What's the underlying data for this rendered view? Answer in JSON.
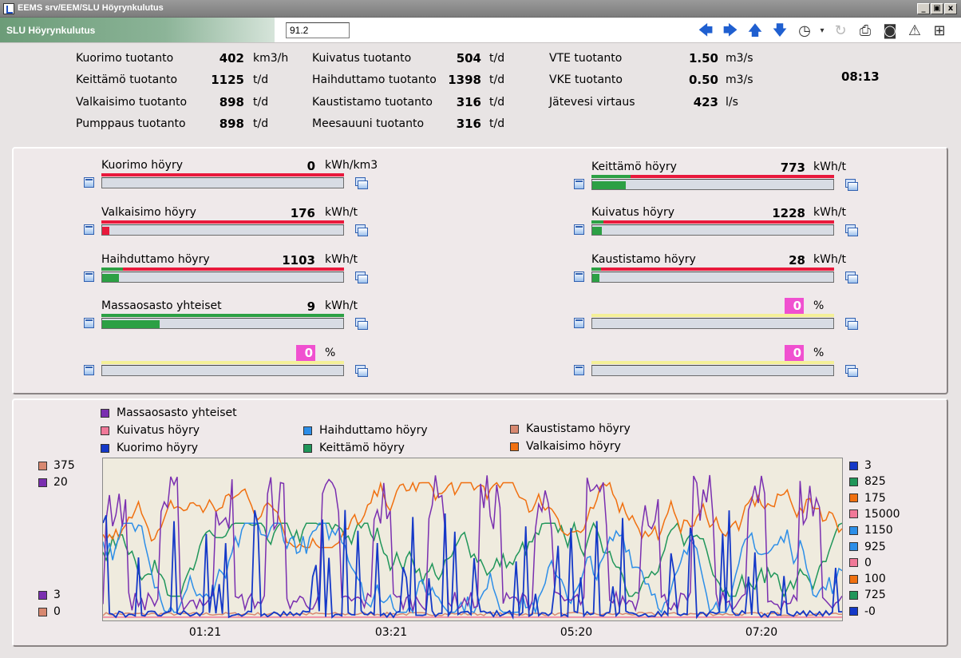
{
  "window": {
    "title": "EEMS srv/EEM/SLU Höyrynkulutus",
    "min_btn": "_",
    "max_btn": "▣",
    "close_btn": "x"
  },
  "toolbar": {
    "screen_title": "SLU Höyrynkulutus",
    "screen_number": "91.2",
    "icons": [
      "back-arrow-icon",
      "forward-arrow-icon",
      "up-arrow-icon",
      "down-arrow-icon",
      "history-clock-icon",
      "dropdown-icon",
      "refresh-icon",
      "print-icon",
      "camera-icon",
      "alarm-icon",
      "zoom-icon"
    ]
  },
  "production": {
    "col1": [
      {
        "label": "Kuorimo tuotanto",
        "value": "402",
        "unit": "km3/h"
      },
      {
        "label": "Keittämö tuotanto",
        "value": "1125",
        "unit": "t/d"
      },
      {
        "label": "Valkaisimo tuotanto",
        "value": "898",
        "unit": "t/d"
      },
      {
        "label": "Pumppaus tuotanto",
        "value": "898",
        "unit": "t/d"
      }
    ],
    "col2": [
      {
        "label": "Kuivatus tuotanto",
        "value": "504",
        "unit": "t/d"
      },
      {
        "label": "Haihduttamo tuotanto",
        "value": "1398",
        "unit": "t/d"
      },
      {
        "label": "Kaustistamo tuotanto",
        "value": "316",
        "unit": "t/d"
      },
      {
        "label": "Meesauuni tuotanto",
        "value": "316",
        "unit": "t/d"
      }
    ],
    "col3": [
      {
        "label": "VTE tuotanto",
        "value": "1.50",
        "unit": "m3/s"
      },
      {
        "label": "VKE tuotanto",
        "value": "0.50",
        "unit": "m3/s"
      },
      {
        "label": "Jätevesi virtaus",
        "value": "423",
        "unit": "l/s"
      }
    ],
    "clock": "08:13"
  },
  "meters": {
    "kuorimo": {
      "label": "Kuorimo höyry",
      "value": "0",
      "unit": "kWh/km3",
      "fill": 0.0,
      "green_fraction": 0.0
    },
    "valkaisimo": {
      "label": "Valkaisimo höyry",
      "value": "176",
      "unit": "kWh/t",
      "fill": 0.03,
      "green_fraction": 0.0
    },
    "haihduttamo": {
      "label": "Haihduttamo höyry",
      "value": "1103",
      "unit": "kWh/t",
      "fill": 0.07,
      "green_fraction": 0.09
    },
    "massaosasto": {
      "label": "Massaosasto yhteiset",
      "value": "9",
      "unit": "kWh/t",
      "fill": 0.24,
      "green_fraction": 1.0
    },
    "left_pct": {
      "value": "0",
      "unit": "%"
    },
    "keittamo": {
      "label": "Keittämö höyry",
      "value": "773",
      "unit": "kWh/t",
      "fill": 0.14,
      "green_fraction": 0.16
    },
    "kuivatus": {
      "label": "Kuivatus höyry",
      "value": "1228",
      "unit": "kWh/t",
      "fill": 0.04,
      "green_fraction": 0.05
    },
    "kaustistamo": {
      "label": "Kaustistamo höyry",
      "value": "28",
      "unit": "kWh/t",
      "fill": 0.03,
      "green_fraction": 0.04
    },
    "right_pct1": {
      "value": "0",
      "unit": "%"
    },
    "right_pct2": {
      "value": "0",
      "unit": "%"
    }
  },
  "colors": {
    "red_limit": "#e8193c",
    "green": "#2ca044",
    "magenta": "#f050d0"
  },
  "chart_data": {
    "type": "line",
    "legend": [
      {
        "name": "Massaosasto yhteiset",
        "color": "#7a2fb0"
      },
      {
        "name": "Kuivatus höyry",
        "color": "#f07898"
      },
      {
        "name": "Kuorimo höyry",
        "color": "#1438c8"
      },
      {
        "name": "Haihduttamo höyry",
        "color": "#2c8ee8"
      },
      {
        "name": "Keittämö höyry",
        "color": "#20965a"
      },
      {
        "name": "Kaustistamo höyry",
        "color": "#d88870"
      },
      {
        "name": "Valkaisimo höyry",
        "color": "#f07010"
      }
    ],
    "left_axis": {
      "top": [
        {
          "value": "375",
          "color": "#d88870"
        },
        {
          "value": "20",
          "color": "#7a2fb0"
        }
      ],
      "bottom": [
        {
          "value": "3",
          "color": "#7a2fb0"
        },
        {
          "value": "0",
          "color": "#d88870"
        }
      ]
    },
    "right_axis": [
      {
        "value": "3",
        "color": "#1438c8"
      },
      {
        "value": "825",
        "color": "#20965a"
      },
      {
        "value": "175",
        "color": "#f07010"
      },
      {
        "value": "15000",
        "color": "#f07898"
      },
      {
        "value": "1150",
        "color": "#2c8ee8"
      },
      {
        "value": "925",
        "color": "#2c8ee8"
      },
      {
        "value": "0",
        "color": "#f07898"
      },
      {
        "value": "100",
        "color": "#f07010"
      },
      {
        "value": "725",
        "color": "#20965a"
      },
      {
        "value": "-0",
        "color": "#1438c8"
      }
    ],
    "x_ticks": [
      "01:21",
      "03:21",
      "05:20",
      "07:20"
    ],
    "series_count": 7
  }
}
